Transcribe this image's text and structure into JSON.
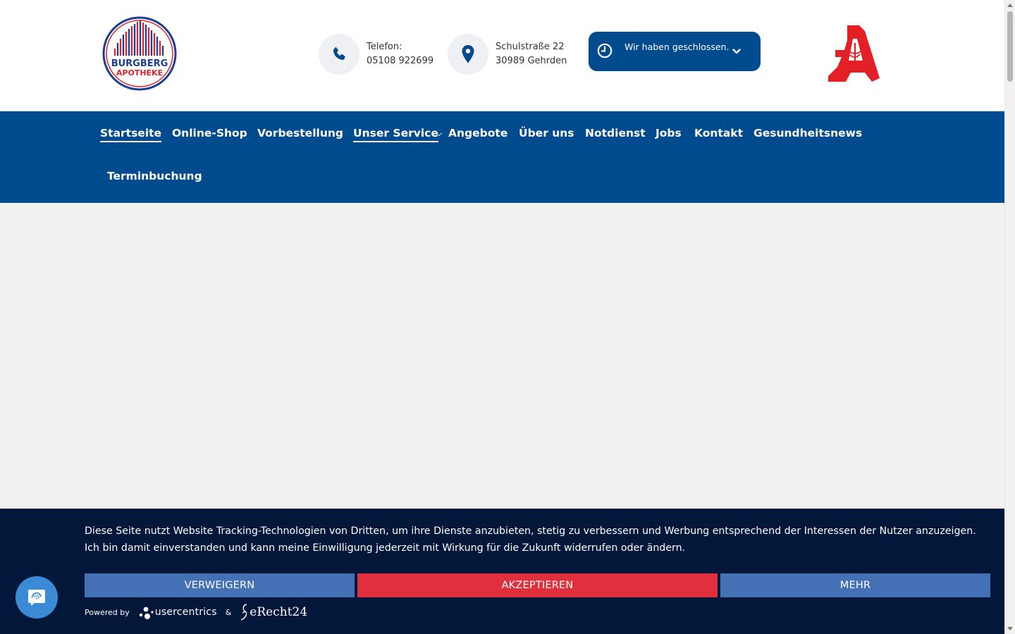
{
  "header": {
    "logo": {
      "line1": "BURGBERG",
      "line2": "APOTHEKE"
    },
    "phone": {
      "label": "Telefon:",
      "number": "05108 922699"
    },
    "address": {
      "street": "Schulstraße 22",
      "city": "30989 Gehrden"
    },
    "hours": {
      "status": "Wir haben geschlossen."
    },
    "colors": {
      "brand_blue": "#004b8d",
      "apo_red": "#e42027"
    }
  },
  "nav": {
    "items": [
      {
        "label": "Startseite"
      },
      {
        "label": "Online-Shop"
      },
      {
        "label": "Vorbestellung"
      },
      {
        "label": "Unser Service"
      },
      {
        "label": "Angebote"
      },
      {
        "label": "Über uns"
      },
      {
        "label": "Notdienst"
      },
      {
        "label": "Jobs"
      },
      {
        "label": "Kontakt"
      },
      {
        "label": "Gesundheitsnews"
      },
      {
        "label": "Terminbuchung"
      }
    ]
  },
  "cookie": {
    "text": "Diese Seite nutzt Website Tracking-Technologien von Dritten, um ihre Dienste anzubieten, stetig zu verbessern und Werbung entsprechend der Interessen der Nutzer anzuzeigen. Ich bin damit einverstanden und kann meine Einwilligung jederzeit mit Wirkung für die Zukunft widerrufen oder ändern.",
    "deny_label": "VERWEIGERN",
    "accept_label": "AKZEPTIEREN",
    "more_label": "MEHR",
    "powered_by": "Powered by",
    "usercentrics": "usercentrics",
    "amp": "&",
    "erecht": "eRecht24",
    "colors": {
      "background": "#03173a",
      "deny": "#4471b5",
      "accept": "#e0303d"
    }
  }
}
